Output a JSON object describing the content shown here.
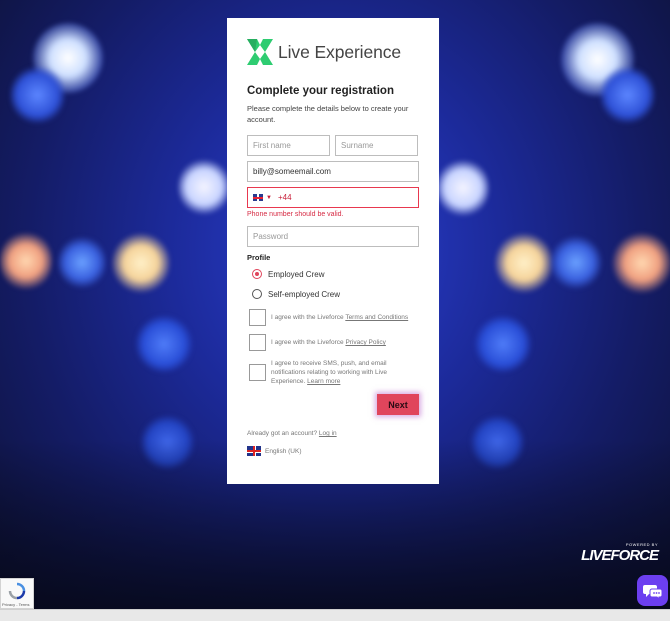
{
  "brand": {
    "name": "Live Experience",
    "accent": "#e0455c",
    "logo_green": "#2ecc71"
  },
  "form": {
    "title": "Complete your registration",
    "subtitle": "Please complete the details below to create your account.",
    "first_name": {
      "placeholder": "First name",
      "value": ""
    },
    "surname": {
      "placeholder": "Surname",
      "value": ""
    },
    "email": {
      "value": "billy@someemail.com"
    },
    "phone": {
      "country_flag": "uk-flag-icon",
      "dial_code": "+44",
      "error": "Phone number should be valid."
    },
    "password": {
      "placeholder": "Password"
    },
    "profile_label": "Profile",
    "profile_options": [
      {
        "label": "Employed Crew",
        "selected": true
      },
      {
        "label": "Self-employed Crew",
        "selected": false
      }
    ],
    "agreements": [
      {
        "prefix": "I agree with the Liveforce ",
        "link": "Terms and Conditions",
        "suffix": ""
      },
      {
        "prefix": "I agree with the Liveforce ",
        "link": "Privacy Policy",
        "suffix": ""
      },
      {
        "prefix": "I agree to receive SMS, push, and email notifications relating to working with Live Experience. ",
        "link": "Learn more",
        "suffix": ""
      }
    ],
    "next_label": "Next",
    "login_prompt": "Already got an account? ",
    "login_link": "Log in",
    "language": "English (UK)"
  },
  "footer": {
    "powered_by": "POWERED BY",
    "liveforce": "LIVEFORCE",
    "recaptcha_label": "Privacy - Terms"
  },
  "icons": {
    "chat": "chat-icon",
    "recaptcha": "recaptcha-icon"
  }
}
